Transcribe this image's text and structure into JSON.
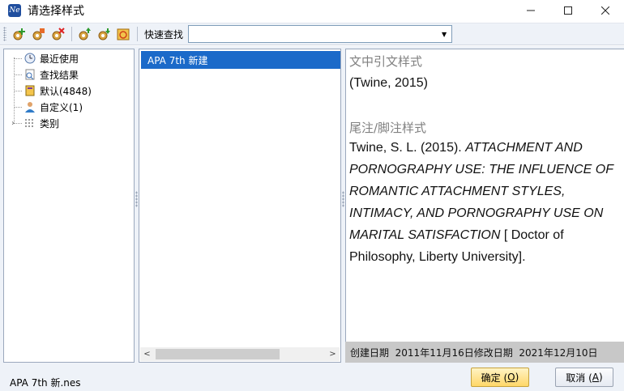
{
  "window": {
    "title": "请选择样式",
    "icon_label": "Ne"
  },
  "toolbar": {
    "quick_find_label": "快速查找",
    "quick_find_value": ""
  },
  "tree": {
    "items": [
      {
        "label": "最近使用",
        "icon": "clock-icon"
      },
      {
        "label": "查找结果",
        "icon": "search-document-icon"
      },
      {
        "label": "默认(4848)",
        "icon": "book-icon"
      },
      {
        "label": "自定义(1)",
        "icon": "user-icon"
      },
      {
        "label": "类别",
        "icon": "grid-icon"
      }
    ]
  },
  "list": {
    "items": [
      "APA 7th 新建"
    ]
  },
  "preview": {
    "in_text_heading": "文中引文样式",
    "in_text_citation": "(Twine, 2015)",
    "note_heading": "尾注/脚注样式",
    "ref_author": "Twine, S. L. (2015). ",
    "ref_title": "ATTACHMENT AND PORNOGRAPHY USE: THE INFLUENCE OF ROMANTIC ATTACHMENT STYLES, INTIMACY, AND PORNOGRAPHY USE ON MARITAL SATISFACTION",
    "ref_tail": " [ Doctor of Philosophy, Liberty University].",
    "created_label": "创建日期",
    "created_date": "2011年11月16日",
    "modified_label": "修改日期",
    "modified_date": "2021年12月10日"
  },
  "footer": {
    "file_name": "APA 7th 新.nes",
    "ok_label": "确定 (",
    "ok_key": "O",
    "ok_end": ")",
    "cancel_label": "取消 (",
    "cancel_key": "A",
    "cancel_end": ")"
  },
  "colors": {
    "selection": "#1b6ac9",
    "toolbar_bg": "#eef2f8",
    "ok_button": "#ffd768"
  }
}
